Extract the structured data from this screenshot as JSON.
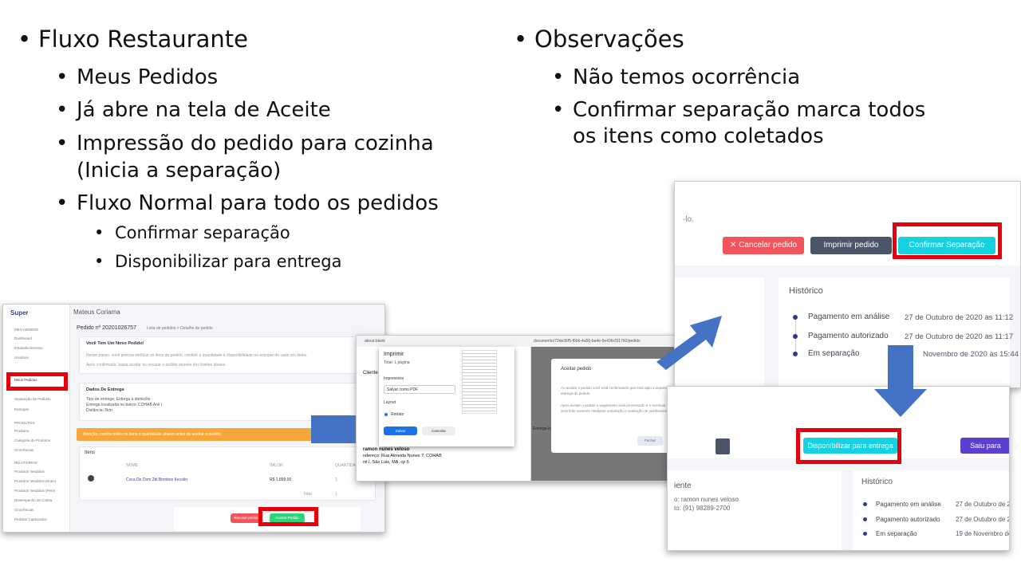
{
  "left": {
    "title": "Fluxo Restaurante",
    "items": [
      "Meus Pedidos",
      "Já abre na tela de Aceite",
      "Impressão do pedido para cozinha",
      "(Inicia a separação)",
      "Fluxo Normal para todo os pedidos"
    ],
    "subitems": [
      "Confirmar separação",
      "Disponibilizar para entrega"
    ]
  },
  "right": {
    "title": "Observações",
    "items": [
      "Não temos ocorrência",
      "Confirmar separação marca todos",
      "os itens como coletados"
    ]
  },
  "shot1": {
    "brand": "Super",
    "user": "Mateus Coriama",
    "order_title": "Pedido nº 20201026757",
    "breadcrumb": "Lista de pedidos  >  Detalhe de pedido",
    "sidebar": [
      "MEU ADMINIS",
      "Dashboard",
      "Estabelecimentos",
      "Usuários",
      "Meus Pedidos",
      "Separação de Pedidos",
      "Entregas",
      "PRODUTOS",
      "Produtos",
      "Categoria de Produtos",
      "Ocorrências",
      "RELATÓRIOS",
      "Produtos Vendidos",
      "Produtos Vendidos Dinero",
      "Produtos Vendidos (Perm",
      "Desempenho de Coleta",
      "Ocorrências",
      "Pedidos Capturados"
    ],
    "new_order_title": "Você Tem Um Novo Pedido!",
    "new_order_text": "Nesse passo, você precisa verificar os itens do pedido, conferir a quantidade e disponibilidade no estoque de cada um deles.",
    "new_order_text2": "Após confirmado, basta aceitar ou recusar o pedido através dos botões abaixo.",
    "delivery_title": "Dados De Entrega",
    "delivery_lines": [
      "Tipo de entrega: Entrega à domicílio",
      "Entrega localizada no bairro: COHAB Anil I",
      "Distância: 5km"
    ],
    "alert": "Atenção, confira todos os itens e quantidade abaixo antes de aceitar o pedido.",
    "items_title": "Itens",
    "col_nome": "NOME",
    "col_valor": "VALOR",
    "col_qtd": "QUANTIDADE",
    "row_nome": "Coca De Dom 2bl Bombos Kecolin",
    "row_valor": "R$ 1.899,00",
    "row_qtd": "1",
    "total_label": "Total",
    "total_value": "1",
    "recuse_btn": "Recusar pedido",
    "accept_btn": "Aceitar Pedido"
  },
  "shot2": {
    "tab": "about:blank",
    "url": "documento/73de36f5-f6b6-4a56-ba4e-5e436c5f1760/pedido",
    "print_title": "Imprimir",
    "print_pages": "Total: 1 página",
    "printer_label": "Impressora",
    "printer_value": "Salvar como PDF",
    "layout_label": "Layout",
    "layout_value": "Retrato",
    "save_btn": "Salvar",
    "cancel_btn": "Cancelar",
    "doc_lines": [
      "Cliente",
      "ramon nunes veloso",
      "ndereço: Rua Almeida Nunes 7, COHAB",
      "nil I, São Luis, MA, cp 6"
    ],
    "doc_footer": "Entrega localizada no bairro: COHAB Anil I",
    "modal_title": "Aceitar pedido",
    "modal_text1": "Ao aceitar o pedido você está confirmando que está apto a separar e a efetuar a entrega do pedido.",
    "modal_text2": "Após aceitar o pedido e pagamento será processado e o eventual cancelamento será feito somente mediante solicitação e avaliação de justificativa.",
    "modal_close": "Fechar",
    "modal_accept": "Aceitar"
  },
  "shot3": {
    "fragment": "-lo.",
    "cancel_btn": "✕  Cancelar pedido",
    "print_btn": "Imprimir pedido",
    "confirm_btn": "Confirmar Separação",
    "history_title": "Histórico",
    "history": [
      {
        "label": "Pagamento em análise",
        "date": "27 de Outubro de 2020 às 11:12"
      },
      {
        "label": "Pagamento autorizado",
        "date": "27 de Outubro de 2020 às 11:17"
      },
      {
        "label": "Em separação",
        "date": "Novembro de 2020 às 15:44"
      }
    ]
  },
  "shot4": {
    "deliver_btn": "Disponibilizar para entrega",
    "out_btn": "Saiu para",
    "client_title": "iente",
    "client_name": "o: ramon nunes veloso",
    "client_phone": "to: (91) 98289-2700",
    "history_title": "Histórico",
    "history": [
      {
        "label": "Pagamento em análise",
        "date": "27 de Outubro de 2"
      },
      {
        "label": "Pagamento autorizado",
        "date": "27 de Outubro de 2"
      },
      {
        "label": "Em separação",
        "date": "19 de Novembro de 2"
      }
    ]
  },
  "colors": {
    "red": "#e8000b",
    "arrow": "#4472c4",
    "cyan": "#17d0e0",
    "danger": "#f2545b",
    "dark": "#4a5568",
    "purple": "#5b3fd1",
    "green": "#2fd47a"
  }
}
